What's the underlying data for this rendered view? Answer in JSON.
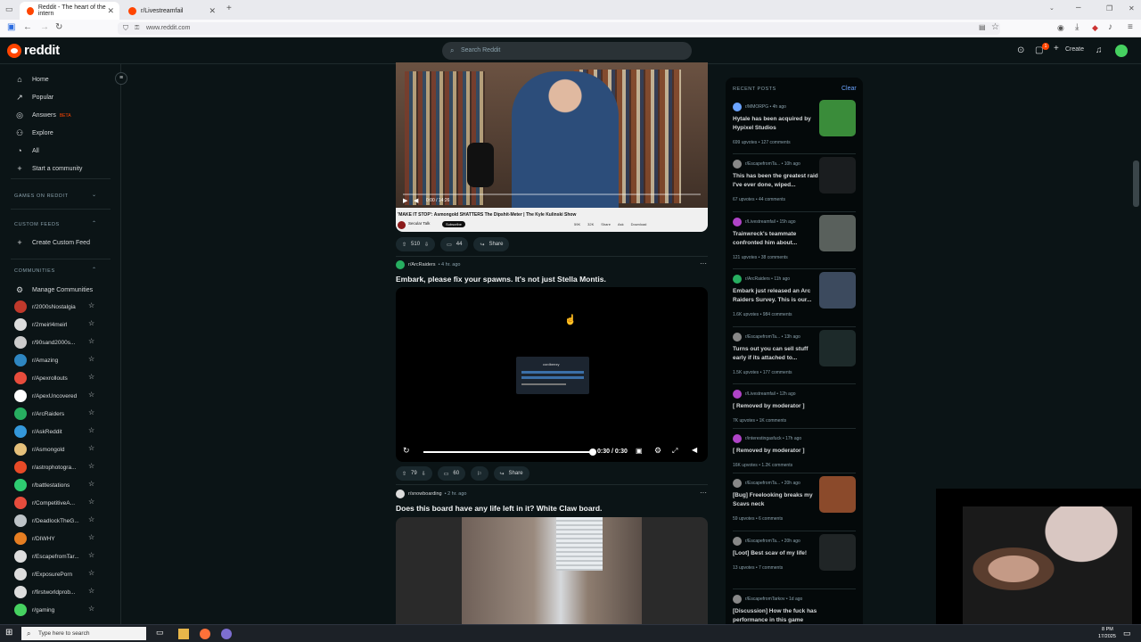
{
  "browser": {
    "tabs": [
      {
        "title": "Reddit - The heart of the intern"
      },
      {
        "title": "r/Livestreamfail"
      }
    ],
    "url": "www.reddit.com"
  },
  "reddit": {
    "logo_text": "reddit",
    "search_placeholder": "Search Reddit",
    "create_label": "Create",
    "notification_count": "1"
  },
  "sidebar": {
    "nav": [
      {
        "label": "Home",
        "icon": "home-icon"
      },
      {
        "label": "Popular",
        "icon": "popular-icon"
      },
      {
        "label": "Answers",
        "badge": "BETA",
        "icon": "answers-icon"
      },
      {
        "label": "Explore",
        "icon": "explore-icon"
      },
      {
        "label": "All",
        "icon": "all-icon"
      },
      {
        "label": "Start a community",
        "icon": "plus-icon"
      }
    ],
    "games_heading": "GAMES ON REDDIT",
    "custom_feeds_heading": "CUSTOM FEEDS",
    "create_custom_feed": "Create Custom Feed",
    "communities_heading": "COMMUNITIES",
    "manage_communities": "Manage Communities",
    "communities": [
      {
        "name": "r/2000sNostalgia",
        "color": "#c0392b"
      },
      {
        "name": "r/2meirl4meirl",
        "color": "#dddddd"
      },
      {
        "name": "r/90sand2000s...",
        "color": "#cccccc"
      },
      {
        "name": "r/Amazing",
        "color": "#2e86c1"
      },
      {
        "name": "r/Apexrollouts",
        "color": "#e74c3c"
      },
      {
        "name": "r/ApexUncovered",
        "color": "#ffffff"
      },
      {
        "name": "r/ArcRaiders",
        "color": "#27ae60"
      },
      {
        "name": "r/AskReddit",
        "color": "#3498db"
      },
      {
        "name": "r/Asmongold",
        "color": "#e5c07b"
      },
      {
        "name": "r/astrophotogra...",
        "color": "#e84a27"
      },
      {
        "name": "r/battlestations",
        "color": "#2ecc71"
      },
      {
        "name": "r/CompetitiveA...",
        "color": "#e74c3c"
      },
      {
        "name": "r/DeadlockTheG...",
        "color": "#bdc3c7"
      },
      {
        "name": "r/DIWHY",
        "color": "#e67e22"
      },
      {
        "name": "r/EscapefromTar...",
        "color": "#dddddd"
      },
      {
        "name": "r/ExposurePorn",
        "color": "#dddddd"
      },
      {
        "name": "r/firstworldprob...",
        "color": "#dddddd"
      },
      {
        "name": "r/gaming",
        "color": "#46d160"
      }
    ]
  },
  "feed": {
    "post1": {
      "video_title": "'MAKE IT STOP': Asmongold SHATTERS The Dipshit-Meter | The Kyle Kulinski Show",
      "channel": "Secular Talk",
      "subscribe": "Subscribe",
      "yt_actions": [
        "59K",
        "32K",
        "Share",
        "Ask",
        "Download"
      ],
      "time": "0:00 / 14:26",
      "votes": "510",
      "comments": "44",
      "share": "Share"
    },
    "post2": {
      "subreddit": "r/ArcRaiders",
      "age": "4 hr. ago",
      "title": "Embark, please fix your spawns. It's not just Stella Montis.",
      "screen_heading": "cordbeezy",
      "video_time": "0:30 / 0:30",
      "progress_fraction": 1.0,
      "votes": "79",
      "comments": "60",
      "share": "Share"
    },
    "post3": {
      "subreddit": "r/snowboarding",
      "age": "2 hr. ago",
      "title": "Does this board have any life left in it? White Claw board."
    }
  },
  "recent": {
    "heading": "RECENT POSTS",
    "clear": "Clear",
    "items": [
      {
        "sub": "r/MMORPG",
        "age": "4h ago",
        "title": "Hytale has been acquired by Hypixel Studios",
        "upvotes": "699 upvotes",
        "comments": "127 comments",
        "color": "#6ba4ff",
        "thumb": "#3a8c3a"
      },
      {
        "sub": "r/EscapefromTa...",
        "age": "10h ago",
        "title": "This has been the greatest raid I've ever done, wiped...",
        "upvotes": "67 upvotes",
        "comments": "44 comments",
        "color": "#888888",
        "thumb": "#1a1d1f"
      },
      {
        "sub": "r/Livestreamfail",
        "age": "15h ago",
        "title": "Trainwreck's teammate confronted him about...",
        "upvotes": "121 upvotes",
        "comments": "38 comments",
        "color": "#b044c8",
        "thumb": "#59605c"
      },
      {
        "sub": "r/ArcRaiders",
        "age": "11h ago",
        "title": "Embark just released an Arc Raiders Survey. This is our...",
        "upvotes": "1.6K upvotes",
        "comments": "984 comments",
        "color": "#27ae60",
        "thumb": "#3c4a5e"
      },
      {
        "sub": "r/EscapefromTa...",
        "age": "13h ago",
        "title": "Turns out you can sell stuff early if its attached to...",
        "upvotes": "1.5K upvotes",
        "comments": "177 comments",
        "color": "#888888",
        "thumb": "#1d2a2a"
      },
      {
        "sub": "r/Livestreamfail",
        "age": "12h ago",
        "title": "[ Removed by moderator ]",
        "upvotes": "7K upvotes",
        "comments": "1K comments",
        "color": "#b044c8"
      },
      {
        "sub": "r/interestingasfuck",
        "age": "17h ago",
        "title": "[ Removed by moderator ]",
        "upvotes": "16K upvotes",
        "comments": "1.2K comments",
        "color": "#b044c8"
      },
      {
        "sub": "r/EscapefromTa...",
        "age": "20h ago",
        "title": "[Bug] Freelooking breaks my Scavs neck",
        "upvotes": "59 upvotes",
        "comments": "6 comments",
        "color": "#888888",
        "thumb": "#8b4a2b"
      },
      {
        "sub": "r/EscapefromTa...",
        "age": "20h ago",
        "title": "[Loot] Best scav of my life!",
        "upvotes": "13 upvotes",
        "comments": "7 comments",
        "color": "#888888",
        "thumb": "#202526"
      },
      {
        "sub": "r/EscapefromTarkov",
        "age": "1d ago",
        "title": "[Discussion] How the fuck has performance in this game gotten worse...",
        "upvotes": "",
        "comments": "",
        "color": "#888888"
      }
    ]
  },
  "taskbar": {
    "search_placeholder": "Type here to search",
    "time": "8 PM",
    "date": "17/2025"
  },
  "colors": {
    "reddit_orange": "#ff4500",
    "background": "#0b1416",
    "link_blue": "#6ba4ff"
  }
}
